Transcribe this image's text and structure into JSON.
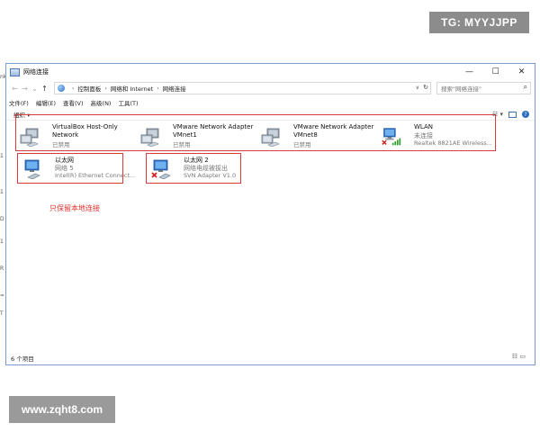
{
  "watermarks": {
    "top": "TG: MYYJJPP",
    "bottom": "www.zqht8.com"
  },
  "window": {
    "title": "网络连接",
    "controls": [
      "—",
      "☐",
      "✕"
    ],
    "nav": {
      "back": "←",
      "forward": "→",
      "recent": "⌄",
      "up": "↑"
    },
    "breadcrumb": [
      "控制面板",
      "网络和 Internet",
      "网络连接"
    ],
    "search_placeholder": "搜索\"网络连接\"",
    "menu": [
      "文件(F)",
      "编辑(E)",
      "查看(V)",
      "高级(N)",
      "工具(T)"
    ],
    "organize": "组织 ▾",
    "status_text": "6 个项目",
    "annotation": "只保留本地连接"
  },
  "connections": [
    {
      "name": "VirtualBox Host-Only",
      "name2": "Network",
      "status": "已禁用",
      "state": "disabled"
    },
    {
      "name": "VMware Network Adapter",
      "name2": "VMnet1",
      "status": "已禁用",
      "state": "disabled"
    },
    {
      "name": "VMware Network Adapter",
      "name2": "VMnet8",
      "status": "已禁用",
      "state": "disabled"
    },
    {
      "name": "WLAN",
      "name2": "未连接",
      "status": "Realtek 8821AE Wireless...",
      "state": "unconnected"
    },
    {
      "name": "以太网",
      "name2": "网络  5",
      "status": "Intel(R) Ethernet Connect...",
      "state": "connected"
    },
    {
      "name": "以太网 2",
      "name2": "网络电缆被拔出",
      "status": "SVN Adapter V1.0",
      "state": "unplugged"
    }
  ],
  "colors": {
    "highlight": "#d83b3b",
    "accent": "#2b6cc0"
  }
}
